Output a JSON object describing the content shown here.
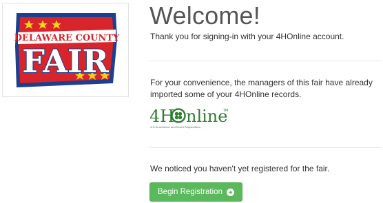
{
  "logo": {
    "line1": "DELAWARE COUNTY",
    "line2": "FAIR",
    "colors": {
      "red": "#d8252b",
      "blue": "#1d3f8f",
      "yellow": "#f6d31a",
      "white": "#ffffff"
    }
  },
  "main": {
    "title": "Welcome!",
    "thanks_text": "Thank you for signing-in with your 4HOnline account.",
    "convenience_text": "For your convenience, the managers of this fair have already imported some of your 4HOnline records.",
    "notice_text": "We noticed you haven't yet registered for the fair."
  },
  "brand": {
    "prefix": "4H",
    "suffix": "nline",
    "tm": "TM",
    "tagline": "4-H Enrollment and Event Registration",
    "color": "#2e7d32"
  },
  "actions": {
    "begin_label": "Begin Registration",
    "begin_icon": "arrow-circle-right-icon",
    "accent": "#5cb85c"
  }
}
